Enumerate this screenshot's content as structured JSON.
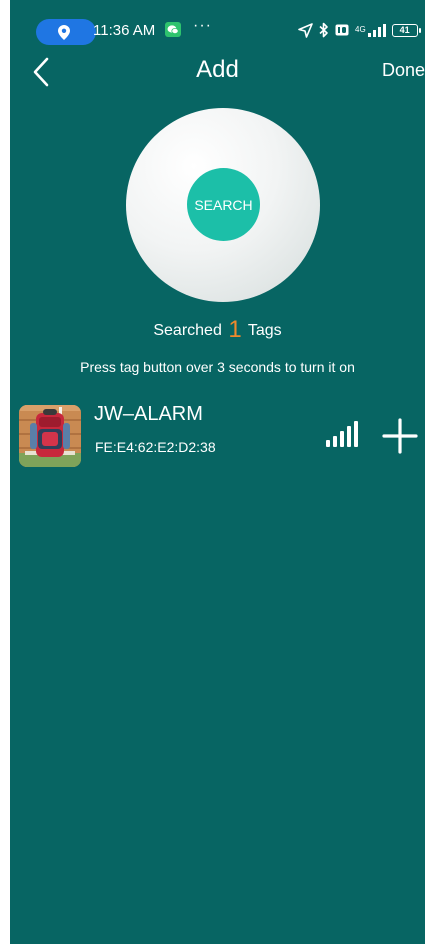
{
  "status_bar": {
    "time": "11:36 AM",
    "dots": "···",
    "network": "4G",
    "battery": "41"
  },
  "header": {
    "title": "Add",
    "done_label": "Done"
  },
  "search": {
    "button_label": "SEARCH",
    "searched_prefix": "Searched",
    "count": "1",
    "searched_suffix": "Tags",
    "hint": "Press tag button over 3 seconds to turn it on"
  },
  "devices": [
    {
      "name": "JW–ALARM",
      "mac": "FE:E4:62:E2:D2:38"
    }
  ],
  "colors": {
    "background": "#076563",
    "search_button": "#1cbfa8",
    "count_accent": "#f0892c",
    "location_pill": "#1f76e3"
  }
}
